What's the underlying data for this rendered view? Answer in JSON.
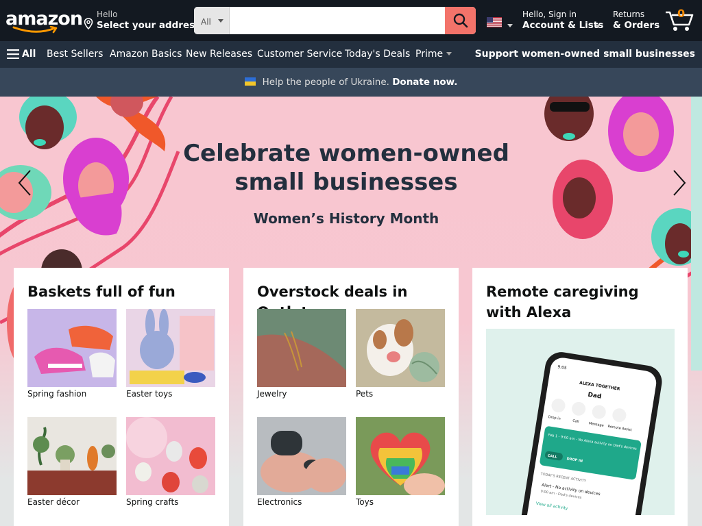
{
  "header": {
    "logo_text": "amazon",
    "address_hello": "Hello",
    "address_label": "Select your address",
    "search_category": "All",
    "search_value": "",
    "account_hello": "Hello, Sign in",
    "account_label": "Account & Lists",
    "returns_line1": "Returns",
    "returns_line2": "& Orders",
    "cart_count": "0",
    "language_flag": "us-flag-icon"
  },
  "nav": {
    "all": "All",
    "items": [
      "Best Sellers",
      "Amazon Basics",
      "New Releases",
      "Customer Service",
      "Today's Deals",
      "Prime"
    ],
    "promo": "Support women-owned small businesses"
  },
  "banner": {
    "text": "Help the people of Ukraine.",
    "link": "Donate now."
  },
  "hero": {
    "title": "Celebrate women-owned small businesses",
    "subtitle": "Women’s History Month"
  },
  "cards": [
    {
      "title": "Baskets full of fun",
      "tiles": [
        "Spring fashion",
        "Easter toys",
        "Easter décor",
        "Spring crafts"
      ]
    },
    {
      "title": "Overstock deals in Outlet",
      "tiles": [
        "Jewelry",
        "Pets",
        "Electronics",
        "Toys"
      ]
    },
    {
      "title": "Remote caregiving with Alexa",
      "phone": {
        "time": "9:05",
        "app_name": "ALEXA TOGETHER",
        "contact": "Dad",
        "actions": [
          "Drop in",
          "Call",
          "Message",
          "Remote Assist"
        ],
        "alert_title": "Feb 1 - 9:00 am - No Alexa activity on Dad's devices",
        "alert_buttons": [
          "CALL",
          "DROP IN"
        ],
        "recent_header": "TODAY'S RECENT ACTIVITY",
        "recent_item": "Alert - No activity on devices",
        "recent_sub": "9:00 am - Dad's devices",
        "view_all": "View all activity"
      }
    }
  ],
  "colors": {
    "topbar": "#131921",
    "navbar": "#232f3e",
    "banner": "#37475a",
    "search_button": "#f3736a",
    "cart_count": "#f08804",
    "hero_bg": "#f8c6d0"
  }
}
